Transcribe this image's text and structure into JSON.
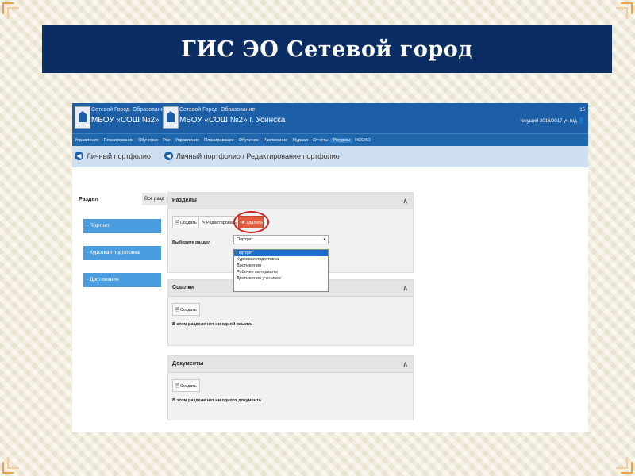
{
  "slide": {
    "title": "ГИС ЭО Сетевой город",
    "colors": {
      "title_bg": "#0b2d63",
      "background": "#f6efdc",
      "accent_orange": "#e8a24a"
    }
  },
  "app": {
    "org_line1": "Сетевой Город. Образование",
    "org_line2": "МБОУ «СОШ №2» г. Усинска",
    "header_right_1": "15",
    "header_right_2": "текущий 2016/2017 уч.год",
    "colors": {
      "header": "#1c5fa6",
      "nav": "#1e67ad",
      "subbar": "#cfe0f1",
      "side_item": "#4a9ee0",
      "delete": "#e05b3f"
    },
    "nav_items": [
      "Управление",
      "Планирование",
      "Обучение",
      "Рас",
      "Управление",
      "Планирование",
      "Обучение",
      "Расписание",
      "Журнал",
      "Отчёты",
      "Ресурсы",
      "НСОКО"
    ],
    "active_nav": "Ресурсы",
    "breadcrumb_back": "Личный портфолио",
    "breadcrumb": "Личный портфолио / Редактирование портфолио"
  },
  "left": {
    "title": "Раздел",
    "all_label": "Все разд",
    "items": [
      "- Портрет",
      "- Курсовая подготовка",
      "- Достижения"
    ]
  },
  "sections_panel": {
    "title": "Разделы",
    "create_label": "Создать",
    "edit_label": "Редактировать",
    "delete_label": "Удалить",
    "select_label": "Выберите раздел",
    "selected": "Портрет",
    "options": [
      "Портрет",
      "Курсовая подготовка",
      "Достижения",
      "Рабочие материалы",
      "Достижения учеников"
    ]
  },
  "links_panel": {
    "title": "Ссылки",
    "create_label": "Создать",
    "empty_text": "В этом разделе нет ни одной ссылки"
  },
  "docs_panel": {
    "title": "Документы",
    "create_label": "Создать",
    "empty_text": "В этом разделе нет ни одного документа"
  },
  "icons": [
    "logo-icon",
    "back-arrow-icon",
    "collapse-caret-icon",
    "doc-icon",
    "pencil-icon",
    "delete-icon",
    "dropdown-caret-icon",
    "user-icon"
  ]
}
